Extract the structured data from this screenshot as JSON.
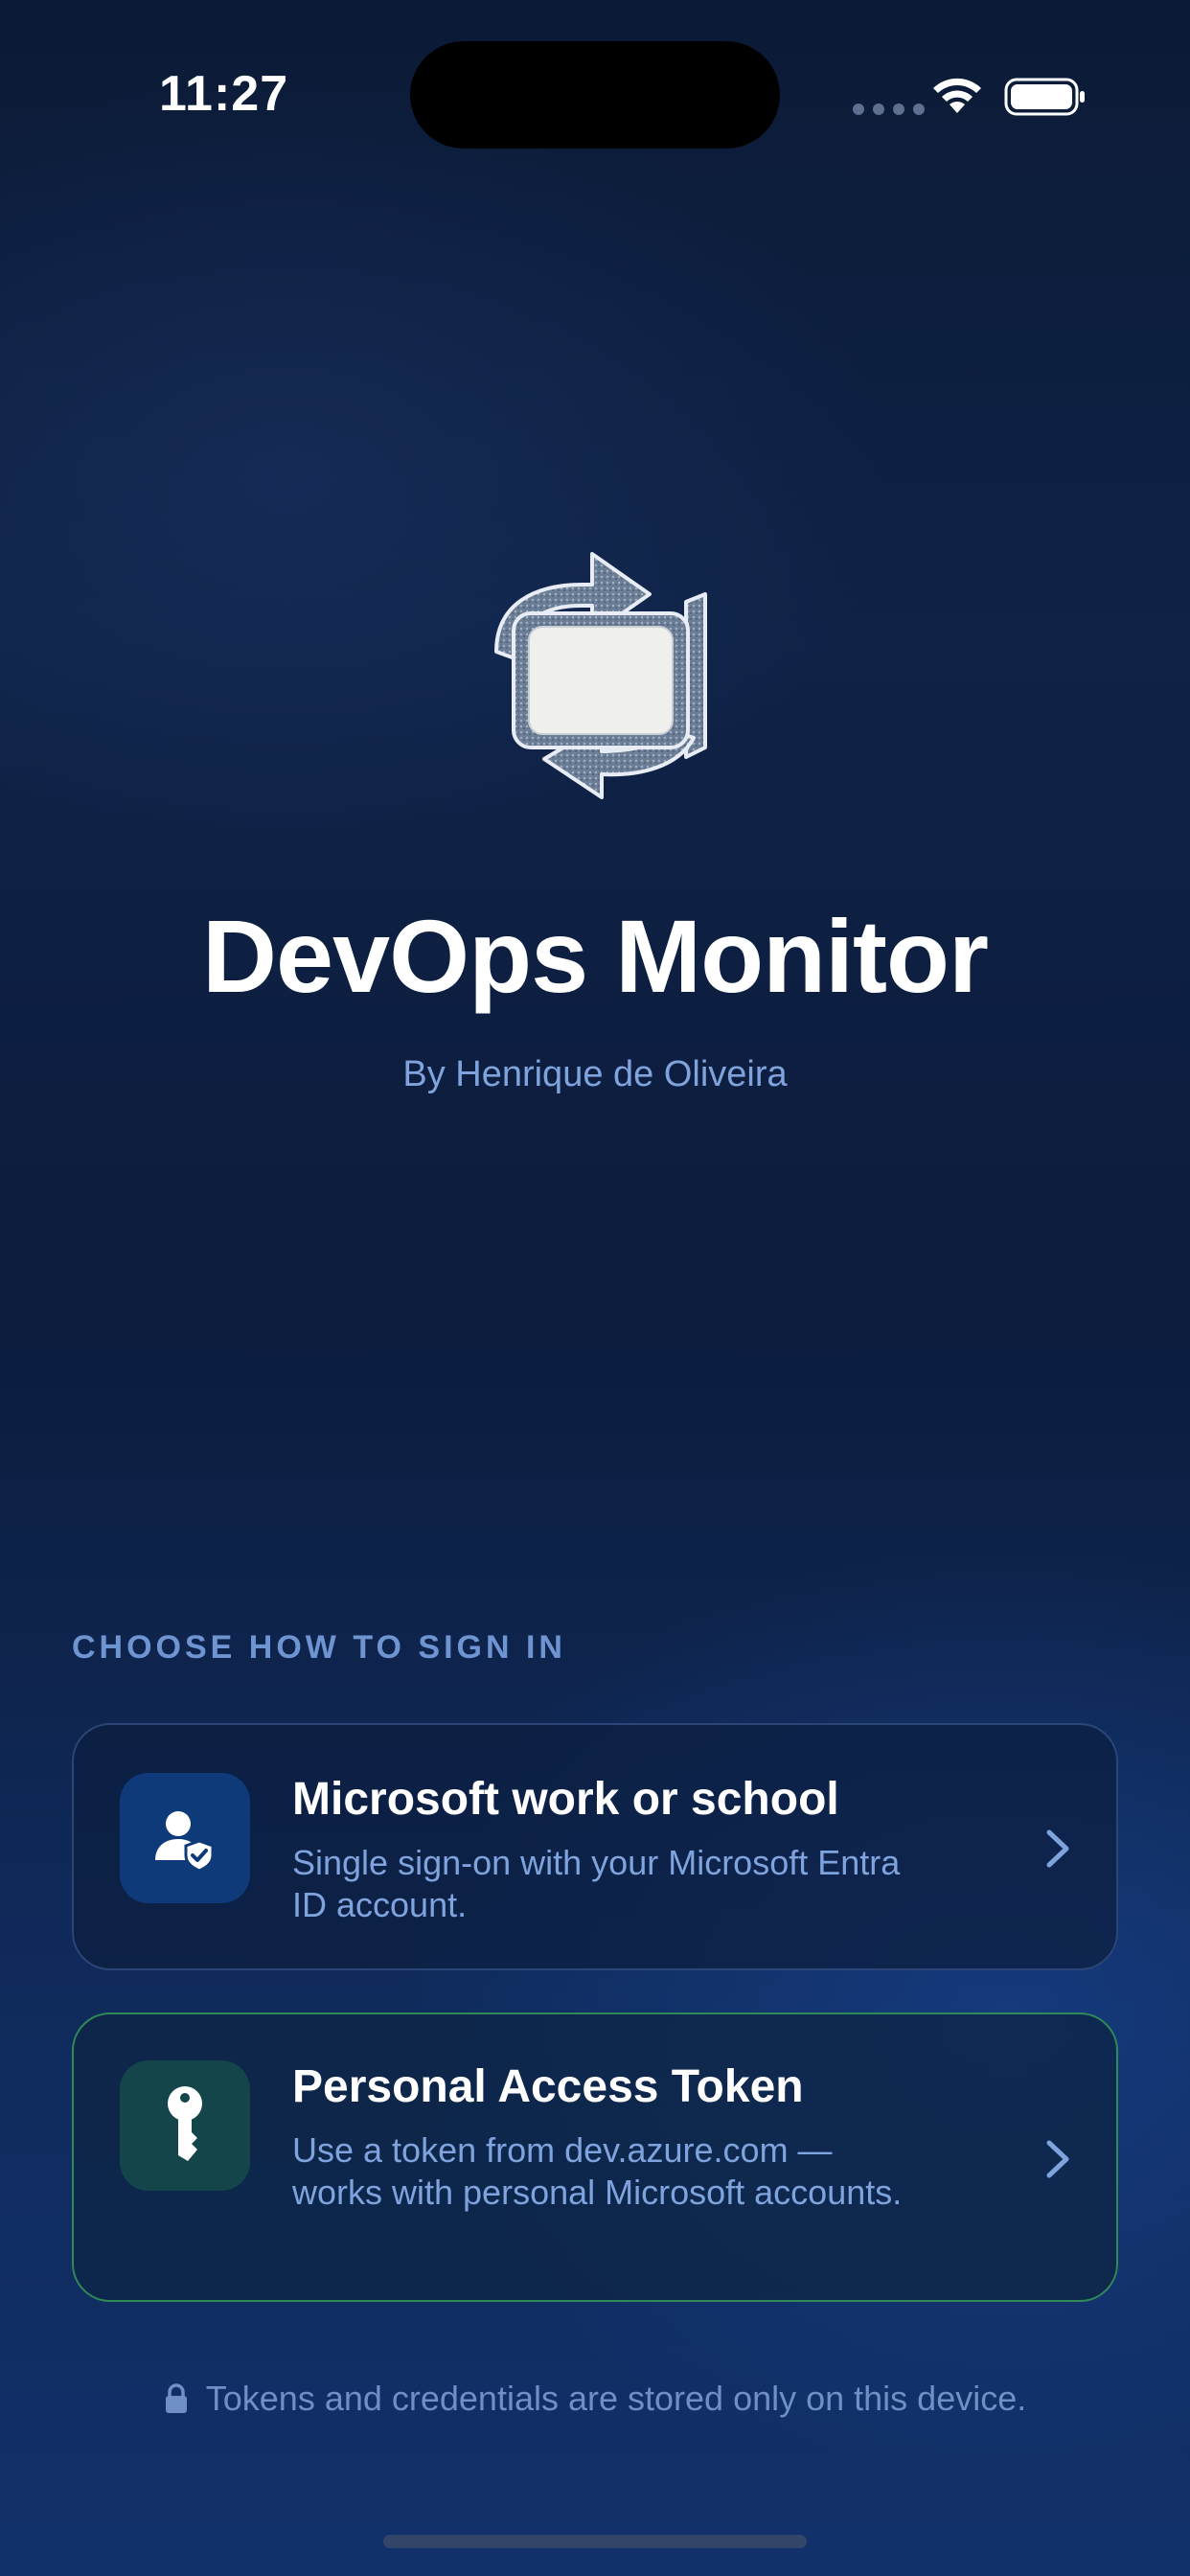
{
  "status_bar": {
    "time": "11:27"
  },
  "app": {
    "title": "DevOps Monitor",
    "author": "By Henrique de Oliveira",
    "logo_icon": "sync-monitor-logo-icon"
  },
  "sign_in": {
    "section_header": "CHOOSE HOW TO SIGN IN",
    "options": [
      {
        "title": "Microsoft work or school",
        "description": "Single sign-on with your Microsoft Entra ID account.",
        "icon": "user-shield-icon",
        "accent_color": "#0f3a7a"
      },
      {
        "title": "Personal Access Token",
        "description": "Use a token from dev.azure.com — works with personal Microsoft accounts.",
        "icon": "key-icon",
        "accent_color": "#2f8a58"
      }
    ]
  },
  "footer": {
    "note": "Tokens and credentials are stored only on this device.",
    "icon": "lock-icon"
  }
}
